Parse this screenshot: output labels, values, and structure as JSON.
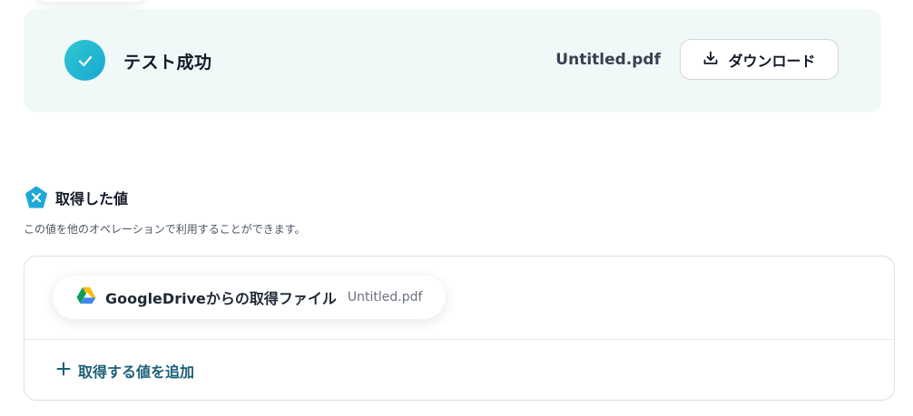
{
  "test_result": {
    "status_label": "テスト成功",
    "file_name": "Untitled.pdf",
    "download_label": "ダウンロード"
  },
  "acquired_values": {
    "title": "取得した値",
    "description": "この値を他のオペレーションで利用することができます。",
    "items": [
      {
        "label": "GoogleDriveからの取得ファイル",
        "value": "Untitled.pdf",
        "icon": "google-drive-icon"
      }
    ],
    "add_label": "取得する値を追加"
  },
  "colors": {
    "accent": "#1aa6d3",
    "success_bg": "#f1f9f8",
    "link": "#1a5f78"
  }
}
